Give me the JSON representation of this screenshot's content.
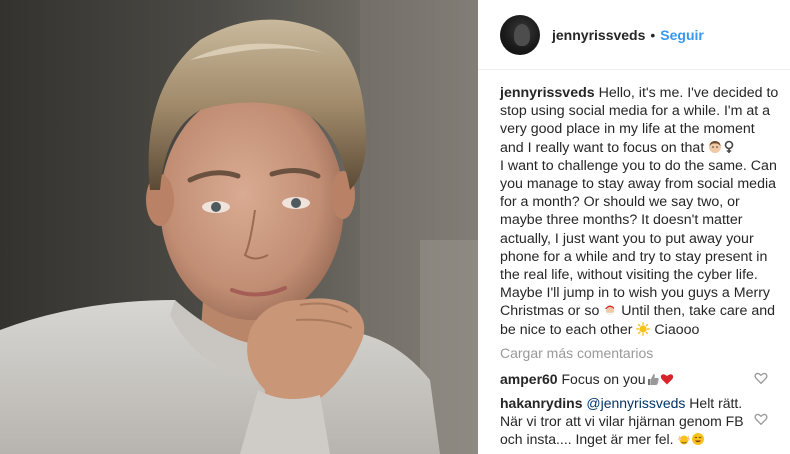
{
  "post": {
    "username": "jennyrissveds",
    "separator": "•",
    "follow_label": "Seguir"
  },
  "caption": {
    "username": "jennyrissveds",
    "part1": "Hello, it's me. I've decided to stop using social media for a while. I'm at a very good place in my life at the moment and I really want to focus on that",
    "part2": "I want to challenge you to do the same. Can you manage to stay away from social media for a month? Or should we say two, or maybe three months? It doesn't matter actually, I just want you to put away your phone for a while and try to stay present in the real life, without visiting the cyber life. Maybe I'll jump in to wish you guys a Merry Christmas or so",
    "part3": "Until then, take care and be nice to each other",
    "part4": "Ciaooo"
  },
  "load_more_label": "Cargar más comentarios",
  "comments": [
    {
      "username": "amper60",
      "text": "Focus on you"
    },
    {
      "username": "hakanrydins",
      "mention": "@jennyrissveds",
      "text": "Helt rätt. När vi tror att vi vilar hjärnan genom FB och insta.... Inget är mer fel."
    }
  ],
  "colors": {
    "accent": "#3897f0",
    "text": "#262626",
    "muted": "#999999",
    "heart_red": "#d8232a"
  },
  "icons": [
    "heart-outline-icon",
    "woman-emoji-icon",
    "santa-emoji-icon",
    "sun-emoji-icon",
    "thumbs-up-emoji-icon",
    "red-heart-emoji-icon",
    "smile-emoji-icon"
  ]
}
